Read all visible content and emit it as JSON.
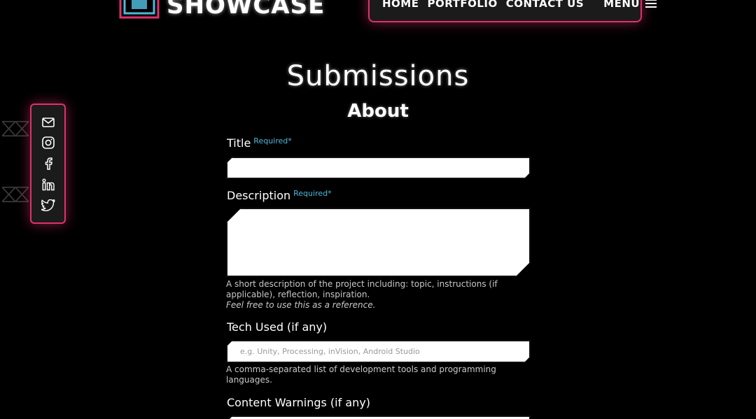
{
  "header": {
    "logo_text": "SHOWCASE",
    "nav": [
      "HOME",
      "PORTFOLIO",
      "CONTACT US"
    ],
    "menu_label": "MENU"
  },
  "social": [
    "mail-icon",
    "instagram-icon",
    "facebook-icon",
    "linkedin-icon",
    "twitter-icon"
  ],
  "page": {
    "title": "Submissions",
    "section": "About"
  },
  "form": {
    "title_label": "Title",
    "title_required": "Required*",
    "description_label": "Description",
    "description_required": "Required*",
    "description_help": "A short description of the project including: topic, instructions (if applicable), reflection, inspiration.",
    "description_help_italic": "Feel free to use this as a reference.",
    "tech_label": "Tech Used (if any)",
    "tech_placeholder": "e.g. Unity, Processing, inVision, Android Studio",
    "tech_help": "A comma-separated list of development tools and programming languages.",
    "warnings_label": "Content Warnings (if any)"
  },
  "colors": {
    "accent": "#e0306e",
    "required": "#4fb7d8",
    "background": "#000000"
  }
}
